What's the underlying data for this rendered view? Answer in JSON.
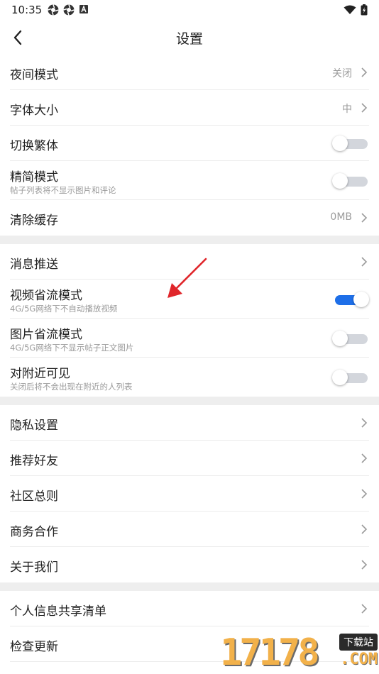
{
  "status_bar": {
    "time": "10:35",
    "left_icons": [
      "aperture-icon",
      "aperture-icon",
      "a-badge-icon"
    ],
    "right_icons": [
      "wifi-icon",
      "battery-charging-icon"
    ]
  },
  "nav": {
    "title": "设置",
    "back_icon": "back-chevron-icon"
  },
  "groups": [
    {
      "rows": [
        {
          "label": "夜间模式",
          "value": "关闭",
          "control": "chevron"
        },
        {
          "label": "字体大小",
          "value": "中",
          "control": "chevron"
        },
        {
          "label": "切换繁体",
          "control": "toggle",
          "on": false
        },
        {
          "label": "精简模式",
          "sub": "帖子列表将不显示图片和评论",
          "control": "toggle",
          "on": false
        },
        {
          "label": "清除缓存",
          "value": "0MB",
          "control": "chevron"
        }
      ]
    },
    {
      "rows": [
        {
          "label": "消息推送",
          "control": "chevron"
        },
        {
          "label": "视频省流模式",
          "sub": "4G/5G网络下不自动播放视频",
          "control": "toggle",
          "on": true
        },
        {
          "label": "图片省流模式",
          "sub": "4G/5G网络下不显示帖子正文图片",
          "control": "toggle",
          "on": false
        },
        {
          "label": "对附近可见",
          "sub": "关闭后将不会出现在附近的人列表",
          "control": "toggle",
          "on": false
        }
      ]
    },
    {
      "rows": [
        {
          "label": "隐私设置",
          "control": "chevron"
        },
        {
          "label": "推荐好友",
          "control": "chevron"
        },
        {
          "label": "社区总则",
          "control": "chevron"
        },
        {
          "label": "商务合作",
          "control": "chevron"
        },
        {
          "label": "关于我们",
          "control": "chevron"
        }
      ]
    },
    {
      "rows": [
        {
          "label": "个人信息共享清单",
          "control": "chevron"
        },
        {
          "label": "检查更新",
          "control": "chevron"
        }
      ]
    }
  ],
  "colors": {
    "accent": "#1e6fe8",
    "arrow": "#e0262b",
    "watermark": "#f2b14a"
  },
  "watermark": {
    "digits": "17178",
    "badge": "下载站",
    "domain": ".COM"
  }
}
